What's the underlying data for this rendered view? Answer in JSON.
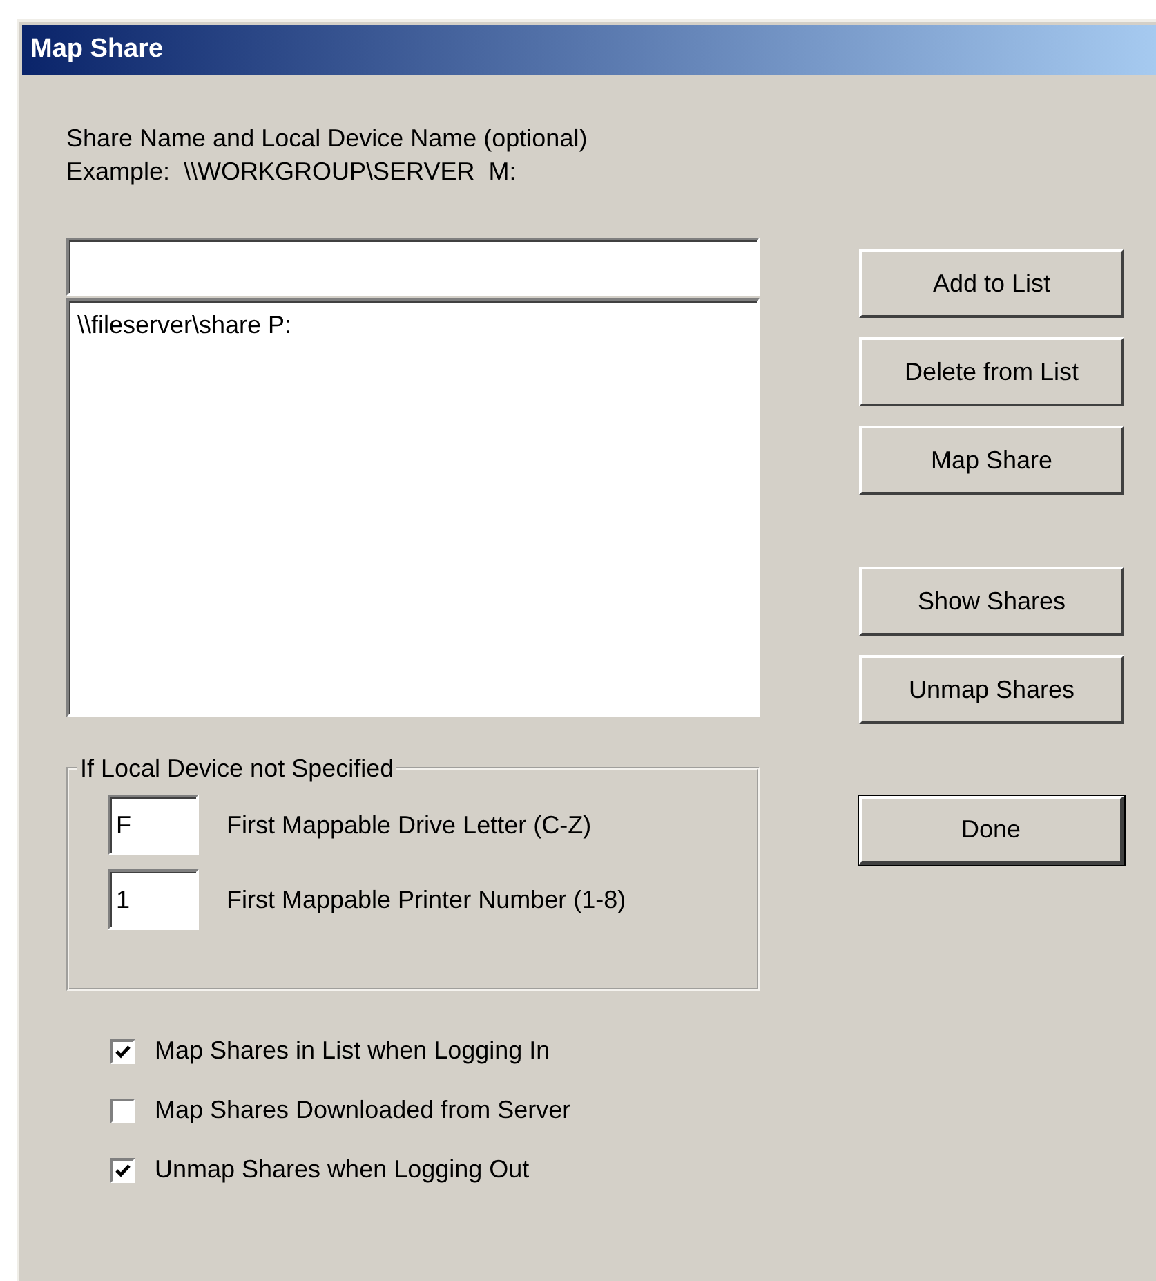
{
  "window": {
    "title": "Map Share"
  },
  "instructions": [
    "Share Name and Local Device Name (optional)",
    "Example:  \\\\WORKGROUP\\SERVER  M:"
  ],
  "share_list": [
    {
      "text": "\\\\fileserver\\share P:",
      "selected": false
    }
  ],
  "button_groups": [
    [
      {
        "label": "Add to List",
        "default": false
      },
      {
        "label": "Delete from List",
        "default": false
      },
      {
        "label": "Map Share",
        "default": false
      }
    ],
    [
      {
        "label": "Show Shares",
        "default": false
      },
      {
        "label": "Unmap Shares",
        "default": false
      }
    ]
  ],
  "group": {
    "title": "If Local Device not Specified",
    "fields": [
      {
        "value": "F",
        "label": "First Mappable Drive Letter (C-Z)"
      },
      {
        "value": "1",
        "label": "First Mappable Printer Number (1-8)"
      }
    ]
  },
  "done_button": {
    "label": "Done",
    "default": true
  },
  "options": [
    {
      "label": "Map Shares in List when Logging In",
      "checked": true
    },
    {
      "label": "Map Shares Downloaded from Server",
      "checked": false
    },
    {
      "label": "Unmap Shares when Logging Out",
      "checked": true
    }
  ]
}
